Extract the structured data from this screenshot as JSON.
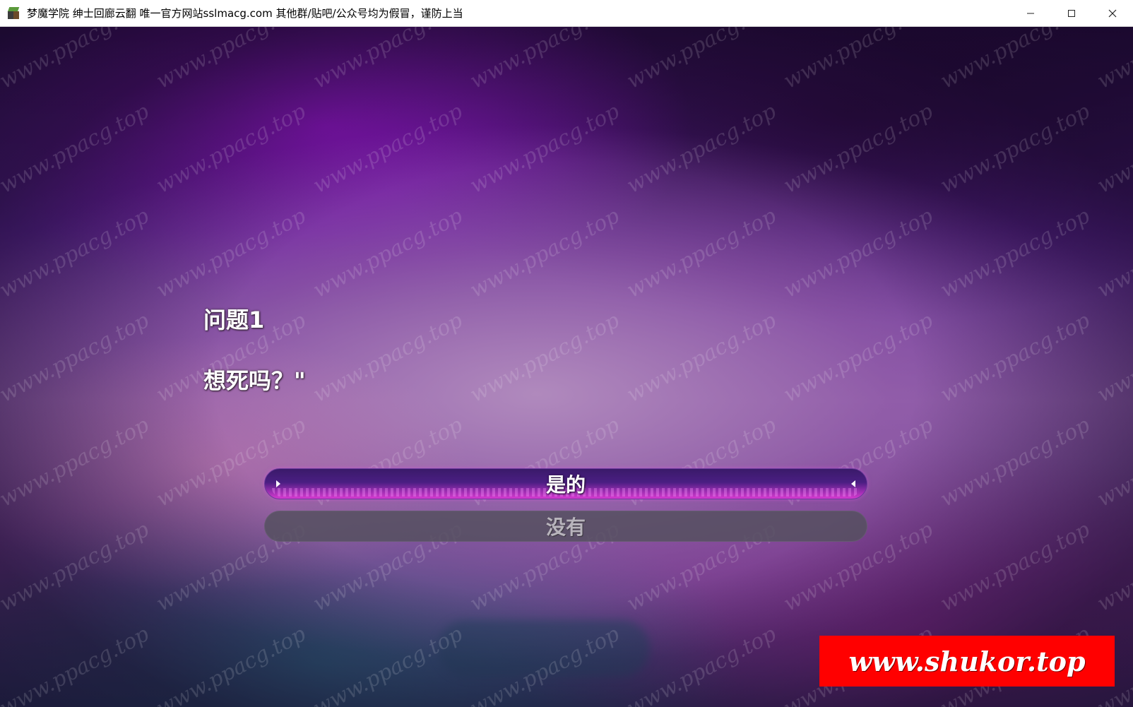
{
  "window": {
    "title": "梦魔学院 绅士回廊云翻 唯一官方网站sslmacg.com 其他群/贴吧/公众号均为假冒，谨防上当",
    "icon": "app-cube-icon",
    "controls": [
      "minimize-icon",
      "maximize-icon",
      "close-icon"
    ]
  },
  "game": {
    "question_title": "问题1",
    "question_text": "想死吗？\"",
    "choices": [
      {
        "label": "是的",
        "state": "selected"
      },
      {
        "label": "没有",
        "state": "unselected"
      }
    ]
  },
  "overlay": {
    "watermark_text": "www.ppacg.top",
    "promo_text": "www.shukor.top",
    "promo_color": "#ff0000"
  }
}
